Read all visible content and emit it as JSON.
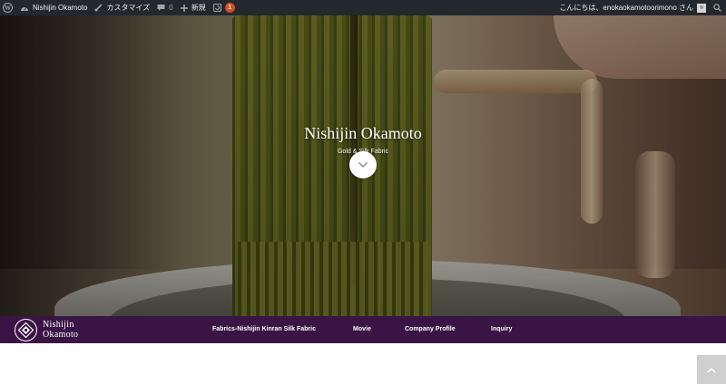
{
  "adminbar": {
    "wp_icon": "wordpress-logo-icon",
    "site_name": "Nishijin Okamoto",
    "customize": "カスタマイズ",
    "comments_count": "0",
    "new_label": "新規",
    "updates_count": "1",
    "greeting": "こんにちは、enokaokamotoorimono さん"
  },
  "hero": {
    "title": "Nishijin Okamoto",
    "subtitle": "Gold & Silk Fabric",
    "scroll_icon": "chevron-down-icon"
  },
  "nav": {
    "logo_line1": "Nishijin",
    "logo_line2": "Okamoto",
    "menu": [
      {
        "label": "Fabrics-Nishijin Kinran Silk Fabric"
      },
      {
        "label": "Movie"
      },
      {
        "label": "Company Profile"
      },
      {
        "label": "Inquiry"
      }
    ]
  },
  "colors": {
    "adminbar_bg": "#23282d",
    "nav_bg": "#3b1446",
    "badge": "#d54e21"
  }
}
